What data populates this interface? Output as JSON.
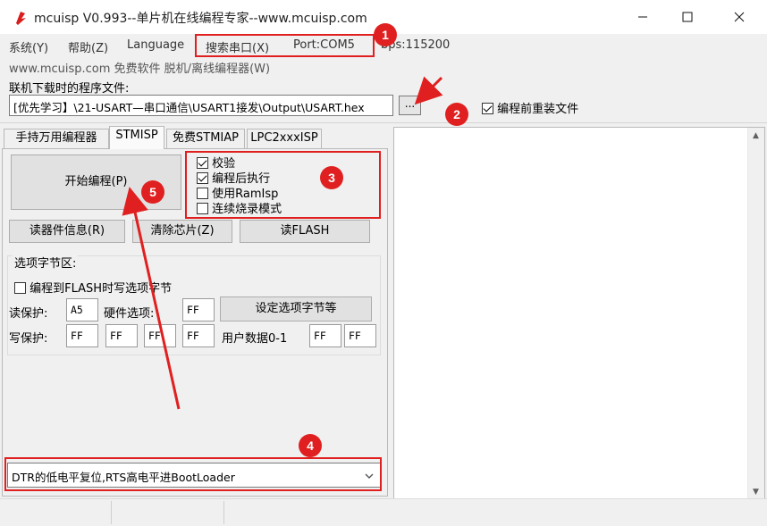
{
  "window": {
    "title": "mcuisp V0.993--单片机在线编程专家--www.mcuisp.com",
    "minimize": "—",
    "maximize": "☐",
    "close": "✕"
  },
  "menu": {
    "items": [
      "系统(Y)",
      "帮助(Z)",
      "Language",
      "搜索串口(X)",
      "Port:COM5",
      "bps:115200"
    ],
    "row2": "www.mcuisp.com 免费软件 脱机/离线编程器(W)"
  },
  "program_file": {
    "label": "联机下载时的程序文件:",
    "path": "[优先学习】\\21-USART—串口通信\\USART1接发\\Output\\USART.hex",
    "browse": "...",
    "reload_label": "编程前重装文件",
    "reload_checked": true
  },
  "tabs": [
    "手持万用编程器",
    "STMISP",
    "免费STMIAP",
    "LPC2xxxISP"
  ],
  "active_tab": 1,
  "buttons": {
    "start": "开始编程(P)",
    "read_info": "读器件信息(R)",
    "erase": "清除芯片(Z)",
    "read_flash": "读FLASH",
    "set_option": "设定选项字节等"
  },
  "options": [
    {
      "label": "校验",
      "checked": true
    },
    {
      "label": "编程后执行",
      "checked": true
    },
    {
      "label": "使用RamIsp",
      "checked": false
    },
    {
      "label": "连续烧录模式",
      "checked": false
    }
  ],
  "option_bytes": {
    "title": "选项字节区:",
    "write_flash_label": "编程到FLASH时写选项字节",
    "write_flash_checked": false,
    "read_protect_label": "读保护:",
    "read_protect_value": "A5",
    "hw_option_label": "硬件选项:",
    "hw_option_value": "FF",
    "write_protect_label": "写保护:",
    "write_protect_values": [
      "FF",
      "FF",
      "FF",
      "FF"
    ],
    "user_data_label": "用户数据0-1",
    "user_data_values": [
      "FF",
      "FF"
    ]
  },
  "boot_mode": "DTR的低电平复位,RTS高电平进BootLoader",
  "annotations": [
    "1",
    "2",
    "3",
    "4",
    "5"
  ],
  "colors": {
    "annotation": "#e02020",
    "window_bg": "#f0f0f0"
  }
}
